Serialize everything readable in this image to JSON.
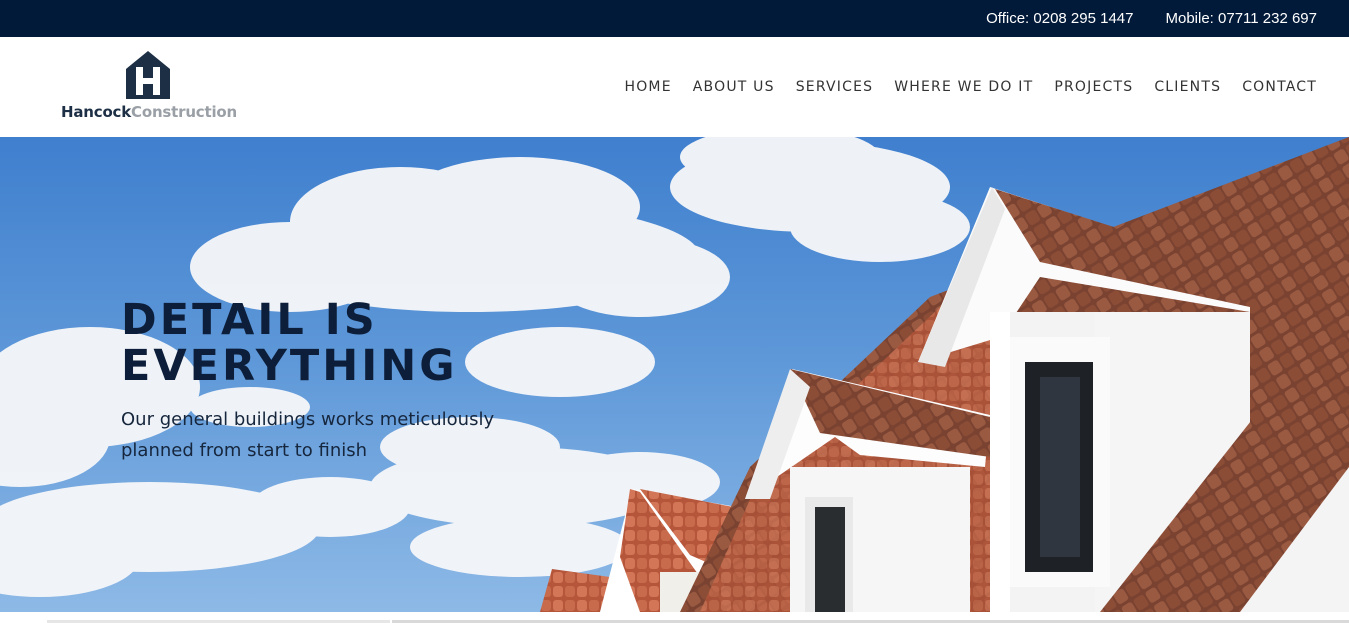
{
  "topbar": {
    "office": "Office: 0208 295 1447",
    "mobile": "Mobile: 07711 232 697"
  },
  "brand": {
    "name_primary": "Hancock",
    "name_secondary": "Construction",
    "icon": "house-h-logo-icon",
    "colors": {
      "primary": "#1d2f45",
      "secondary": "#9aa0a6"
    }
  },
  "nav": {
    "items": [
      {
        "label": "HOME"
      },
      {
        "label": "ABOUT US"
      },
      {
        "label": "SERVICES"
      },
      {
        "label": "WHERE WE DO IT"
      },
      {
        "label": "PROJECTS"
      },
      {
        "label": "CLIENTS"
      },
      {
        "label": "CONTACT"
      }
    ]
  },
  "hero": {
    "title_line1": "DETAIL IS",
    "title_line2": "EVERYTHING",
    "subtitle": "Our general buildings works meticulously planned from start to finish",
    "colors": {
      "title": "#0c1e3a",
      "sky": "#4b88d3",
      "tiles": "#8a4e38"
    }
  },
  "colors": {
    "topbar_bg": "#021a3a",
    "nav_text": "#333333"
  }
}
